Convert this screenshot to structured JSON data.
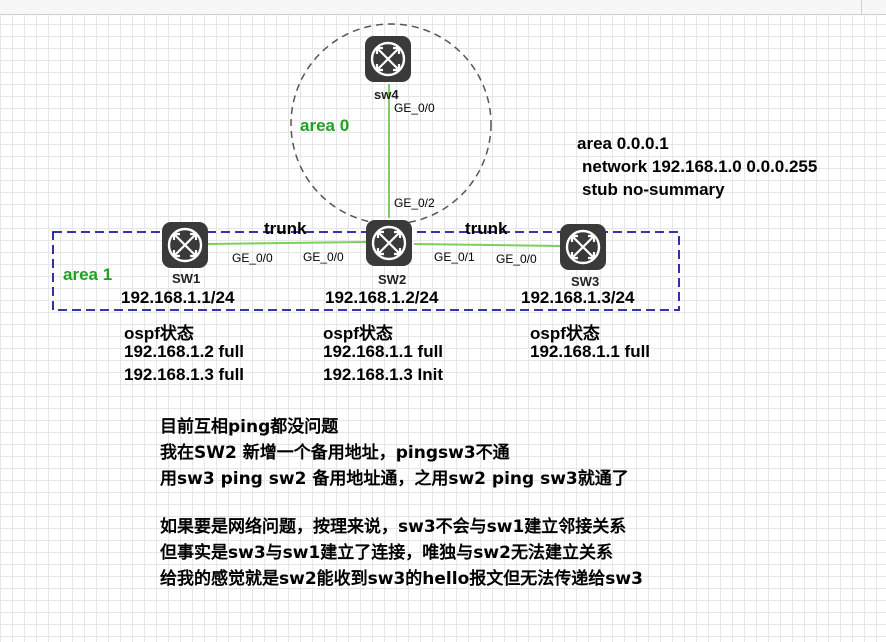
{
  "nodes": {
    "sw1": {
      "name": "SW1",
      "ip": "192.168.1.1/24",
      "port": "GE_0/0",
      "ospf_title": "ospf状态",
      "ospf_lines": [
        "192.168.1.2 full",
        "192.168.1.3 full"
      ]
    },
    "sw2": {
      "name": "SW2",
      "ip": "192.168.1.2/24",
      "port_left": "GE_0/0",
      "port_right": "GE_0/1",
      "port_up": "GE_0/2",
      "ospf_title": "ospf状态",
      "ospf_lines": [
        "192.168.1.1 full",
        "192.168.1.3 Init"
      ]
    },
    "sw3": {
      "name": "SW3",
      "ip": "192.168.1.3/24",
      "port": "GE_0/0",
      "ospf_title": "ospf状态",
      "ospf_lines": [
        "192.168.1.1 full"
      ]
    },
    "sw4": {
      "name": "sw4",
      "port": "GE_0/0"
    }
  },
  "links": {
    "left": "trunk",
    "right": "trunk"
  },
  "areas": {
    "area0": "area 0",
    "area1": "area 1"
  },
  "config": [
    "area 0.0.0.1",
    "network 192.168.1.0 0.0.0.255",
    "stub no-summary"
  ],
  "notes": [
    "目前互相ping都没问题",
    "我在SW2 新增一个备用地址，pingsw3不通",
    "用sw3 ping sw2 备用地址通，之用sw2 ping sw3就通了",
    "",
    "如果要是网络问题，按理来说，sw3不会与sw1建立邻接关系",
    "但事实是sw3与sw1建立了连接，唯独与sw2无法建立关系",
    "给我的感觉就是sw2能收到sw3的hello报文但无法传递给sw3"
  ],
  "colors": {
    "link": "#7ccf5f",
    "area1_border": "#1a1aa0",
    "area_label": "#22a022",
    "router": "#3a3a3a"
  }
}
